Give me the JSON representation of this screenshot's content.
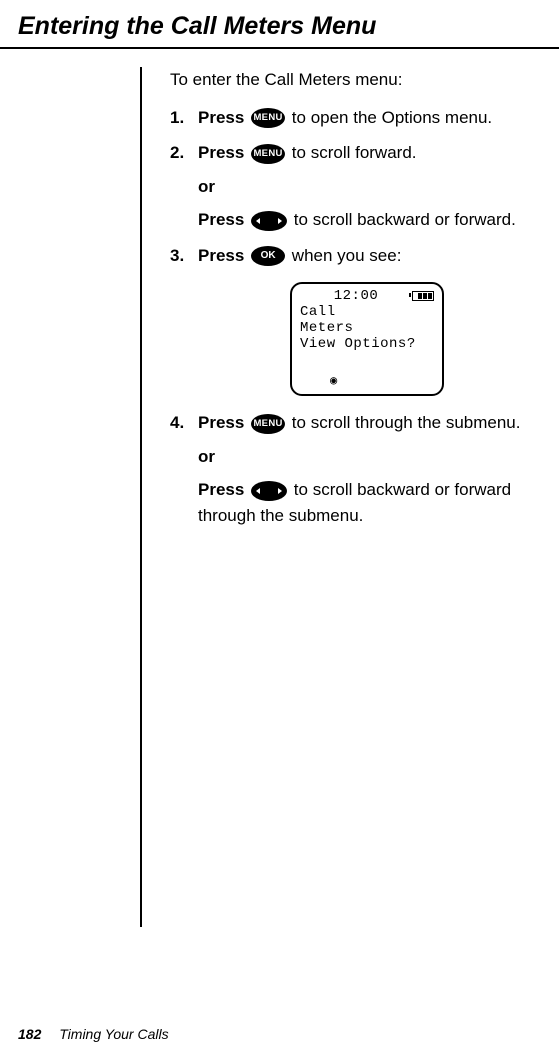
{
  "title": "Entering the Call Meters Menu",
  "intro": "To enter the Call Meters menu:",
  "steps": {
    "s1": {
      "num": "1.",
      "pre": "Press",
      "post": " to open the Options menu."
    },
    "s2": {
      "num": "2.",
      "pre": "Press",
      "post": " to scroll forward."
    },
    "or": "or",
    "s2b": {
      "pre": "Press",
      "post": " to scroll backward or forward."
    },
    "s3": {
      "num": "3.",
      "pre": "Press",
      "post": " when you see:"
    },
    "s4": {
      "num": "4.",
      "pre": "Press",
      "post": " to scroll through the submenu."
    },
    "s4b": {
      "pre": "Press",
      "post": " to scroll backward or forward through the submenu."
    }
  },
  "keys": {
    "menu": "MENU",
    "ok": "OK"
  },
  "screen": {
    "time": "12:00",
    "line1": "Call",
    "line2": "Meters",
    "line3": "View Options?"
  },
  "footer": {
    "page": "182",
    "chapter": "Timing Your Calls"
  }
}
